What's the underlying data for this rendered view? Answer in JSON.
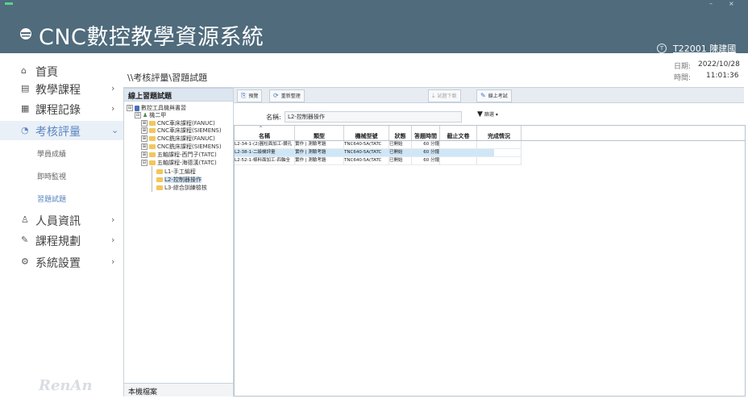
{
  "window": {
    "min_glyph": "–",
    "close_glyph": "×"
  },
  "app": {
    "title": "CNC數控教學資源系統"
  },
  "user": {
    "label": "T22001 陳建國"
  },
  "sidebar": {
    "items": [
      {
        "label": "首頁",
        "icon": "⌂",
        "chevron": ""
      },
      {
        "label": "教學課程",
        "icon": "▤",
        "chevron": "›"
      },
      {
        "label": "課程記錄",
        "icon": "▦",
        "chevron": "›"
      },
      {
        "label": "考核評量",
        "icon": "◔",
        "chevron": "⌄"
      },
      {
        "label": "人員資訊",
        "icon": "♙",
        "chevron": "›"
      },
      {
        "label": "課程規劃",
        "icon": "✎",
        "chevron": "›"
      },
      {
        "label": "系統設置",
        "icon": "⚙",
        "chevron": "›"
      }
    ],
    "subitems": [
      "學員成績",
      "即時監視",
      "習題試題"
    ],
    "brand": "RenAn"
  },
  "breadcrumb": "\\\\考核評量\\習題試題",
  "datetime": {
    "date_label": "日期:",
    "date": "2022/10/28",
    "time_label": "時間:",
    "time": "11:01:36"
  },
  "tree": {
    "header": "線上習題試題",
    "footer": "本機檔案",
    "nodes": [
      {
        "text": "數控工具機與書習",
        "level": 0,
        "toggle": "⊟",
        "kind": "db"
      },
      {
        "text": "機二甲",
        "level": 1,
        "toggle": "⊟",
        "kind": "user"
      },
      {
        "text": "CNC車床課程(FANUC)",
        "level": 2,
        "toggle": "⊞",
        "kind": "folder"
      },
      {
        "text": "CNC車床課程(SIEMENS)",
        "level": 2,
        "toggle": "⊞",
        "kind": "folder"
      },
      {
        "text": "CNC銑床課程(FANUC)",
        "level": 2,
        "toggle": "⊞",
        "kind": "folder"
      },
      {
        "text": "CNC銑床課程(SIEMENS)",
        "level": 2,
        "toggle": "⊞",
        "kind": "folder"
      },
      {
        "text": "五軸課程-西門子(TATC)",
        "level": 2,
        "toggle": "⊞",
        "kind": "folder"
      },
      {
        "text": "五軸課程-海德漢(TATC)",
        "level": 2,
        "toggle": "⊟",
        "kind": "folder"
      },
      {
        "text": "L1-手工編程",
        "level": 3,
        "toggle": "",
        "kind": "folder"
      },
      {
        "text": "L2-控制器操作",
        "level": 3,
        "toggle": "",
        "kind": "folder"
      },
      {
        "text": "L3-綜合訓練檢核",
        "level": 3,
        "toggle": "",
        "kind": "folder"
      }
    ]
  },
  "toolbar": {
    "preview": "預覽",
    "refresh": "重新整理",
    "download": "試題下載",
    "online_exam": "線上考試"
  },
  "filter": {
    "name_label": "名稱:",
    "name_value": "L2-控制器操作",
    "button": "篩選 ▾"
  },
  "grid": {
    "sort_glyph": "^",
    "columns": [
      "名稱",
      "類型",
      "機械型號",
      "狀態",
      "答題時間",
      "截止文卷",
      "完成情況"
    ],
    "rows": [
      [
        "L2-34-1-(2)圓柱面加工-鑽孔",
        "實作 | 測驗考題",
        "TNC640-5A(TATC",
        "已開始",
        "60 分鐘",
        "",
        ""
      ],
      [
        "L2-38-1-二級機評量",
        "實作 | 測驗考題",
        "TNC640-5A(TATC",
        "已開始",
        "60 分鐘",
        "",
        ""
      ],
      [
        "L2-52-1-條料面加工-四軸全",
        "實作 | 測驗考題",
        "TNC640-5A(TATC",
        "已開始",
        "60 分鐘",
        "",
        ""
      ]
    ]
  },
  "colors": {
    "header": "#4f6b7c",
    "accent": "#5b86c0",
    "selected_row": "#cfe6f7"
  }
}
